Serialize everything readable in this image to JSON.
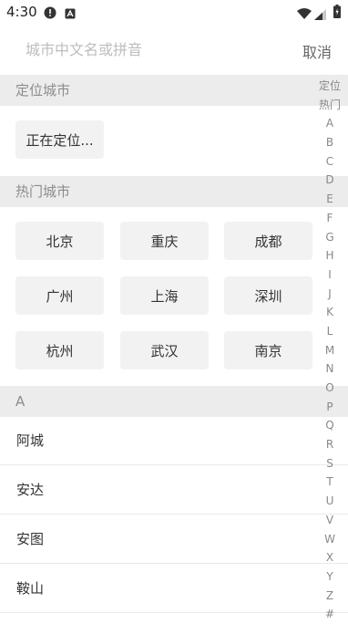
{
  "status": {
    "time": "4:30"
  },
  "search": {
    "placeholder": "城市中文名或拼音",
    "value": "",
    "cancel_label": "取消"
  },
  "location": {
    "header": "定位城市",
    "current": "正在定位..."
  },
  "hot": {
    "header": "热门城市",
    "cities": [
      "北京",
      "重庆",
      "成都",
      "广州",
      "上海",
      "深圳",
      "杭州",
      "武汉",
      "南京"
    ]
  },
  "list": {
    "header": "A",
    "rows": [
      "阿城",
      "安达",
      "安图",
      "鞍山"
    ]
  },
  "index": [
    "定位",
    "热门",
    "A",
    "B",
    "C",
    "D",
    "E",
    "F",
    "G",
    "H",
    "I",
    "J",
    "K",
    "L",
    "M",
    "N",
    "O",
    "P",
    "Q",
    "R",
    "S",
    "T",
    "U",
    "V",
    "W",
    "X",
    "Y",
    "Z",
    "#"
  ]
}
